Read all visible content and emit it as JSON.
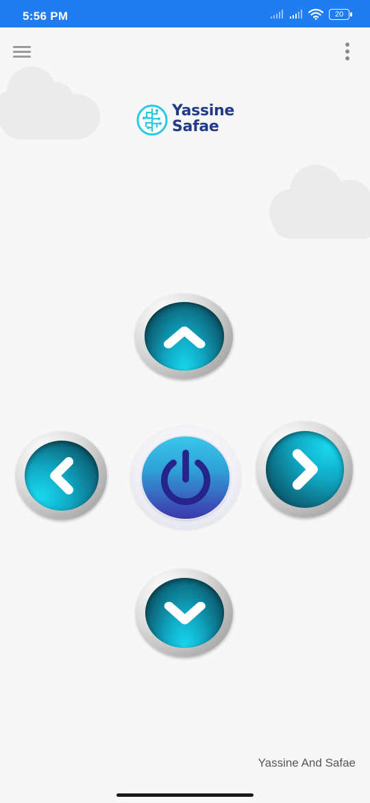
{
  "status_bar": {
    "time": "5:56 PM",
    "battery_level": "20",
    "icons": [
      "signal-icon",
      "signal-icon",
      "wifi-icon",
      "battery-icon"
    ]
  },
  "app_bar": {
    "menu_icon": "hamburger-menu-icon",
    "more_icon": "more-vertical-icon"
  },
  "logo": {
    "line1": "Yassine",
    "line2": "Safae",
    "icon": "circuit-brain-icon",
    "colors": {
      "text": "#233a86",
      "icon": "#28c8e8"
    }
  },
  "controls": {
    "up": {
      "icon": "chevron-up-icon"
    },
    "left": {
      "icon": "chevron-left-icon"
    },
    "power": {
      "icon": "power-icon"
    },
    "right": {
      "icon": "chevron-right-icon"
    },
    "down": {
      "icon": "chevron-down-icon"
    },
    "colors": {
      "accent": "#10a8c4",
      "power": "#3b4fb8"
    }
  },
  "footer": {
    "label": "Yassine And Safae"
  }
}
